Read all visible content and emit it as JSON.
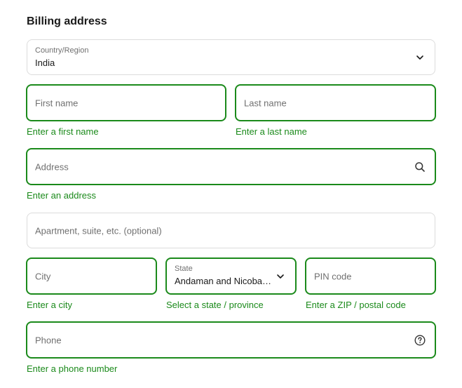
{
  "section_title": "Billing address",
  "country": {
    "label": "Country/Region",
    "value": "India",
    "icon": "chevron-down-icon"
  },
  "first_name": {
    "placeholder": "First name",
    "error": "Enter a first name"
  },
  "last_name": {
    "placeholder": "Last name",
    "error": "Enter a last name"
  },
  "address": {
    "placeholder": "Address",
    "error": "Enter an address",
    "icon": "search-icon"
  },
  "apartment": {
    "placeholder": "Apartment, suite, etc. (optional)"
  },
  "city": {
    "placeholder": "City",
    "error": "Enter a city"
  },
  "state": {
    "label": "State",
    "value": "Andaman and Nicoba…",
    "error": "Select a state / province",
    "icon": "chevron-down-icon"
  },
  "pin": {
    "placeholder": "PIN code",
    "error": "Enter a ZIP / postal code"
  },
  "phone": {
    "placeholder": "Phone",
    "error": "Enter a phone number",
    "icon": "help-circle-icon"
  },
  "colors": {
    "error": "#1b8a1b",
    "border": "#dcdcdc",
    "placeholder": "#707070",
    "text": "#1a1a1a"
  }
}
